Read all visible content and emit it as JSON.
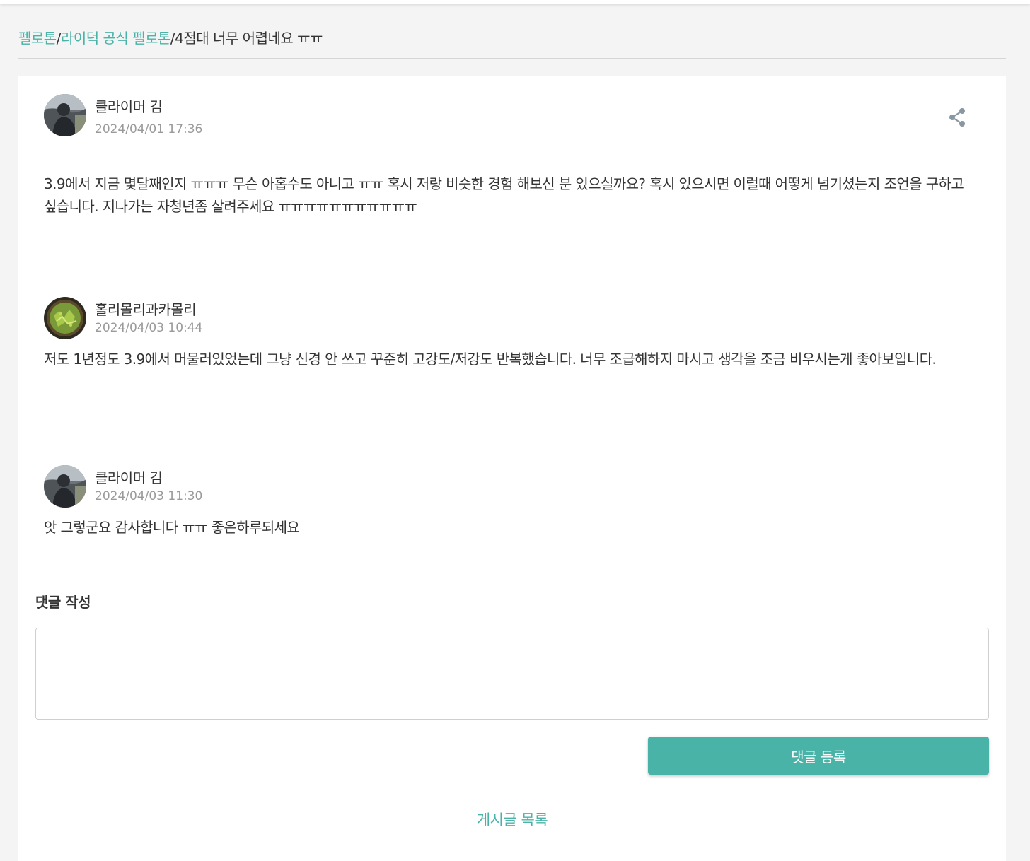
{
  "breadcrumb": {
    "items": [
      "펠로톤",
      "라이덕 공식 펠로톤"
    ],
    "separator": "/",
    "current": "4점대 너무 어렵네요 ㅠㅠ"
  },
  "post": {
    "author": "클라이머 김",
    "date": "2024/04/01 17:36",
    "share_icon": "share-icon",
    "body": "3.9에서 지금 몇달째인지 ㅠㅠㅠ 무슨 아홉수도 아니고 ㅠㅠ 혹시 저랑 비슷한 경험 해보신 분 있으실까요? 혹시 있으시면 이럴때 어떻게 넘기셨는지 조언을 구하고 싶습니다. 지나가는 자청년좀 살려주세요 ㅠㅠㅠㅠㅠㅠㅠㅠㅠㅠㅠ"
  },
  "comments": [
    {
      "author": "홀리몰리과카몰리",
      "date": "2024/04/03 10:44",
      "body": "저도 1년정도 3.9에서 머물러있었는데 그냥 신경 안 쓰고 꾸준히 고강도/저강도 반복했습니다. 너무 조급해하지 마시고 생각을 조금 비우시는게 좋아보입니다."
    },
    {
      "author": "클라이머 김",
      "date": "2024/04/03 11:30",
      "body": "앗 그렇군요 감사합니다 ㅠㅠ 좋은하루되세요"
    }
  ],
  "comment_form": {
    "heading": "댓글 작성",
    "placeholder": "",
    "submit_label": "댓글 등록"
  },
  "footer": {
    "list_link": "게시글 목록"
  },
  "colors": {
    "accent": "#4ab3a8",
    "text": "#333333",
    "muted": "#9a9a9a",
    "background": "#f4f4f4"
  }
}
